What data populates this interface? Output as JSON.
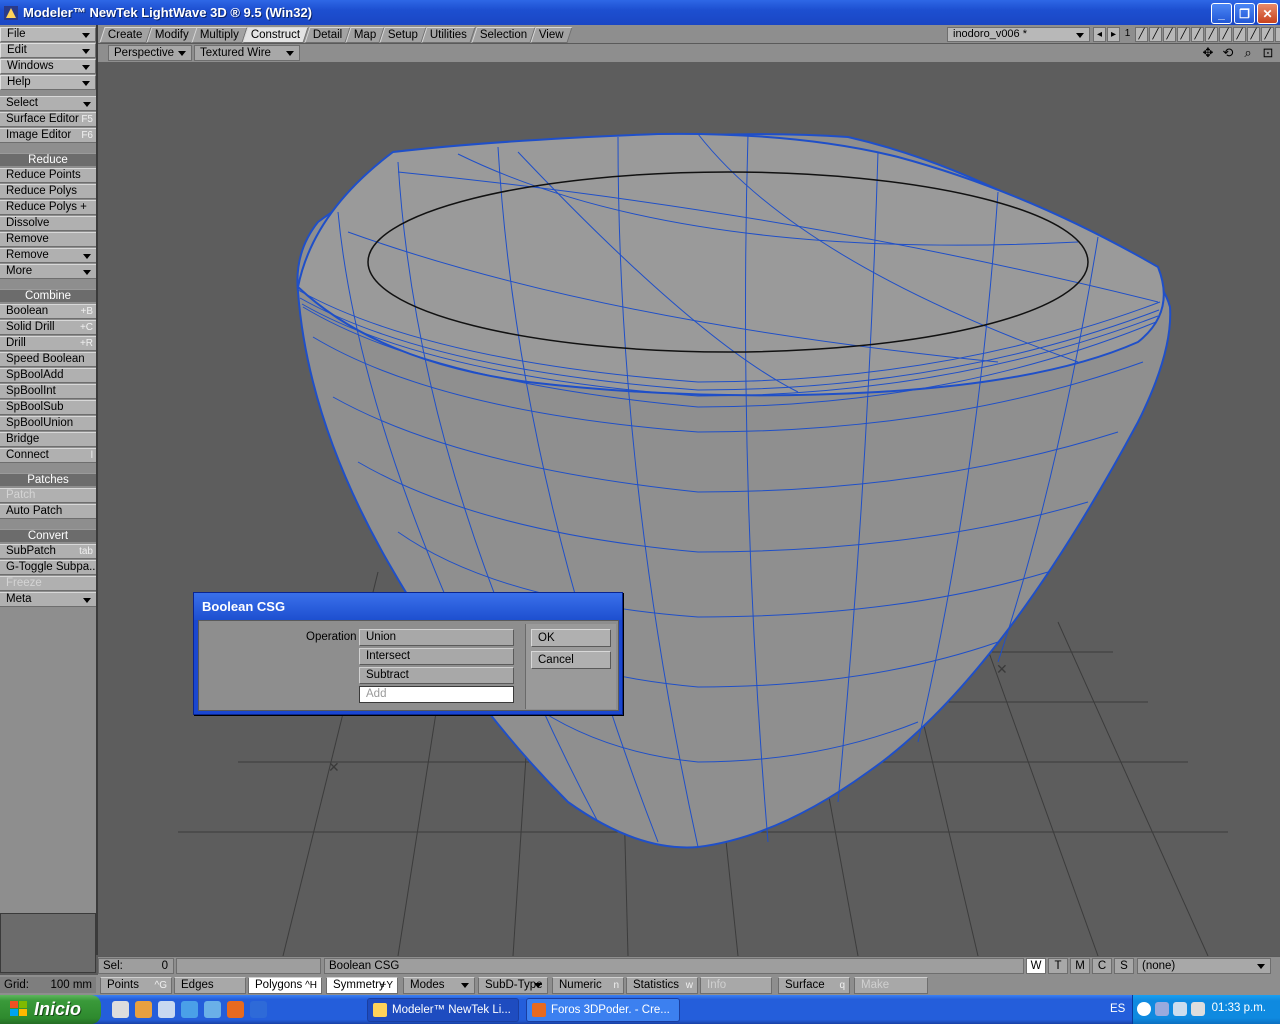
{
  "window": {
    "title": "Modeler™ NewTek LightWave 3D ® 9.5  (Win32)"
  },
  "menus": {
    "file": "File",
    "edit": "Edit",
    "windows": "Windows",
    "help": "Help"
  },
  "tabs": [
    "Create",
    "Modify",
    "Multiply",
    "Construct",
    "Detail",
    "Map",
    "Setup",
    "Utilities",
    "Selection",
    "View"
  ],
  "active_tab": "Construct",
  "object": {
    "name": "inodoro_v006 *",
    "layer_num": "1"
  },
  "viewport": {
    "projection": "Perspective",
    "render_mode": "Textured Wire"
  },
  "sidebar": {
    "select": "Select",
    "surface_editor": {
      "label": "Surface Editor",
      "key": "F5"
    },
    "image_editor": {
      "label": "Image Editor",
      "key": "F6"
    },
    "reduce_header": "Reduce",
    "reduce_points": "Reduce Points",
    "reduce_polys": "Reduce Polys",
    "reduce_polys_plus": "Reduce Polys +",
    "dissolve": "Dissolve",
    "remove": "Remove",
    "remove_drop": "Remove",
    "more": "More",
    "combine_header": "Combine",
    "boolean": {
      "label": "Boolean",
      "key": "+B"
    },
    "solid_drill": {
      "label": "Solid Drill",
      "key": "+C"
    },
    "drill": {
      "label": "Drill",
      "key": "+R"
    },
    "speed_boolean": "Speed Boolean",
    "spbooladd": "SpBoolAdd",
    "spboolint": "SpBoolInt",
    "spboolsub": "SpBoolSub",
    "spboolunion": "SpBoolUnion",
    "bridge": "Bridge",
    "connect": {
      "label": "Connect",
      "key": "l"
    },
    "patches_header": "Patches",
    "patch": "Patch",
    "auto_patch": "Auto Patch",
    "convert_header": "Convert",
    "subpatch": {
      "label": "SubPatch",
      "key": "tab"
    },
    "g_toggle": "G-Toggle Subpa...",
    "freeze": "Freeze",
    "meta": "Meta"
  },
  "dialog": {
    "title": "Boolean CSG",
    "operation_label": "Operation",
    "options": [
      "Union",
      "Intersect",
      "Subtract",
      "Add"
    ],
    "selected": "Add",
    "ok": "OK",
    "cancel": "Cancel"
  },
  "status": {
    "sel_label": "Sel:",
    "sel_value": "0",
    "message": "Boolean CSG",
    "wtmcs": [
      "W",
      "T",
      "M",
      "C",
      "S"
    ],
    "active_wtmcs": "W",
    "surface_value": "(none)"
  },
  "bottombar": {
    "grid_label": "Grid:",
    "grid_value": "100 mm",
    "points": {
      "label": "Points",
      "key": "^G"
    },
    "edges": "Edges",
    "polygons": {
      "label": "Polygons",
      "key": "^H"
    },
    "symmetry": {
      "label": "Symmetry",
      "key": "+Y"
    },
    "modes": "Modes",
    "subd_type": "SubD-Type",
    "numeric": {
      "label": "Numeric",
      "key": "n"
    },
    "statistics": {
      "label": "Statistics",
      "key": "w"
    },
    "info": "Info",
    "surface": {
      "label": "Surface",
      "key": "q"
    },
    "make": "Make"
  },
  "taskbar": {
    "start": "Inicio",
    "tasks": [
      "Modeler™ NewTek Li...",
      "Foros 3DPoder. - Cre..."
    ],
    "lang": "ES",
    "clock": "01:33 p.m."
  },
  "colors": {
    "wire": "#1f4fc8",
    "mesh_fill": "#8f8f8f",
    "xp_blue": "#245edb"
  }
}
